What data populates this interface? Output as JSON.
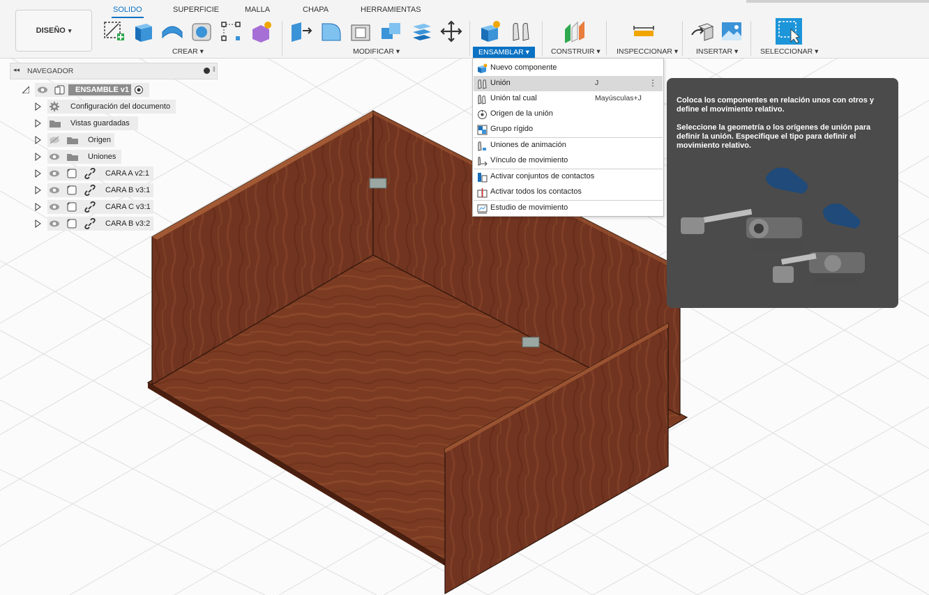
{
  "workspace": {
    "label": "DISEÑO",
    "caret": "▾"
  },
  "tabs": [
    "SOLIDO",
    "SUPERFICIE",
    "MALLA",
    "CHAPA",
    "HERRAMIENTAS"
  ],
  "active_tab": "SOLIDO",
  "groups": {
    "crear": "CREAR ▾",
    "modificar": "MODIFICAR ▾",
    "ensamblar": "ENSAMBLAR ▾",
    "construir": "CONSTRUIR ▾",
    "inspeccionar": "INSPECCIONAR ▾",
    "insertar": "INSERTAR ▾",
    "seleccionar": "SELECCIONAR ▾"
  },
  "navigator": {
    "title": "NAVEGADOR",
    "root": "ENSAMBLE v1",
    "items": [
      {
        "label": "Configuración del documento",
        "icon": "gear-icon"
      },
      {
        "label": "Vistas guardadas",
        "icon": "folder-icon"
      },
      {
        "label": "Origen",
        "icon": "folder-icon"
      },
      {
        "label": "Uniones",
        "icon": "folder-icon"
      },
      {
        "label": "CARA A v2:1",
        "icon": "component-icon"
      },
      {
        "label": "CARA B v3:1",
        "icon": "component-icon"
      },
      {
        "label": "CARA C v3:1",
        "icon": "component-icon"
      },
      {
        "label": "CARA B v3:2",
        "icon": "component-icon"
      }
    ]
  },
  "menu": {
    "items": [
      {
        "label": "Nuevo componente",
        "shortcut": ""
      },
      {
        "label": "Unión",
        "shortcut": "J"
      },
      {
        "label": "Unión tal cual",
        "shortcut": "Mayúsculas+J"
      },
      {
        "label": "Origen de la unión",
        "shortcut": ""
      },
      {
        "label": "Grupo rígido",
        "shortcut": ""
      },
      {
        "label": "Uniones de animación",
        "shortcut": ""
      },
      {
        "label": "Vínculo de movimiento",
        "shortcut": ""
      },
      {
        "label": "Activar conjuntos de contactos",
        "shortcut": ""
      },
      {
        "label": "Activar todos los contactos",
        "shortcut": ""
      },
      {
        "label": "Estudio de movimiento",
        "shortcut": ""
      }
    ],
    "kebab": "⋮"
  },
  "tooltip": {
    "line1": "Coloca los componentes en relación unos con otros y define el movimiento relativo.",
    "line2": "Seleccione la geometría o los orígenes de unión para definir la unión. Especifique el tipo para definir el movimiento relativo."
  },
  "colors": {
    "accent": "#0a72c4",
    "wood": "#7a3a22",
    "tooltip_bg": "#4b4b4b"
  }
}
